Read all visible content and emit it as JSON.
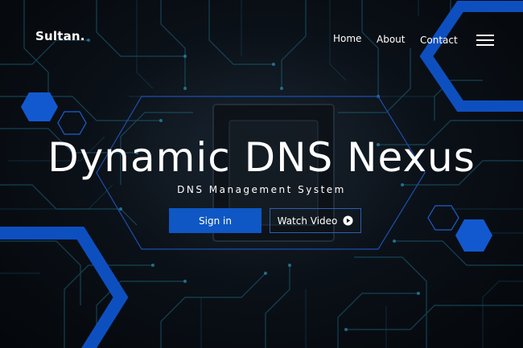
{
  "header": {
    "brand": "Sultan."
  },
  "nav": {
    "items": [
      {
        "label": "Home"
      },
      {
        "label": "About"
      },
      {
        "label": "Contact"
      }
    ],
    "menu_icon": "hamburger-menu-icon"
  },
  "hero": {
    "title": "Dynamic DNS Nexus",
    "subtitle": "DNS Management System",
    "primary_button": "Sign in",
    "secondary_button": "Watch Video",
    "secondary_icon": "play-circle-icon"
  },
  "colors": {
    "accent": "#0e57c4",
    "hex_outline": "#1d4fb0",
    "background": "#05080d",
    "text": "#ffffff"
  }
}
